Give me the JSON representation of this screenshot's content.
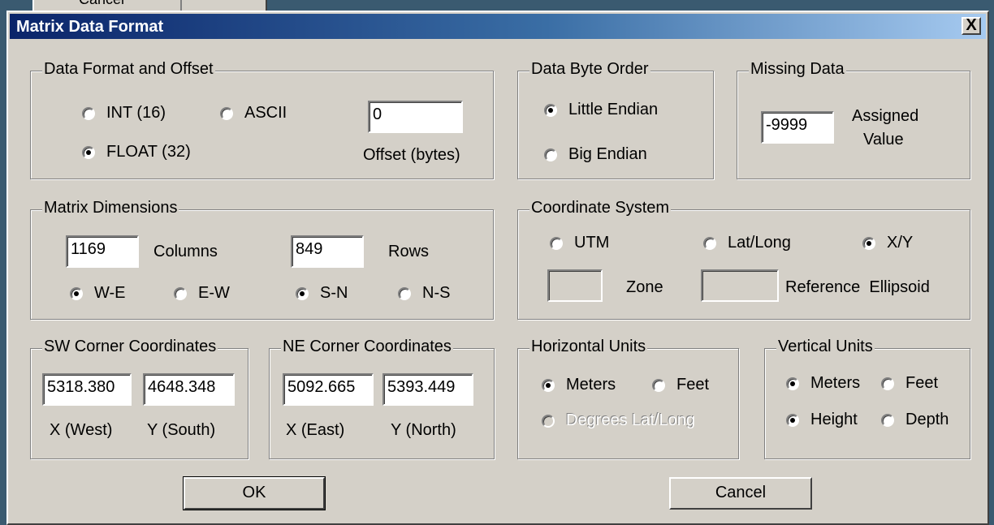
{
  "background_tab": {
    "label": "Cancel"
  },
  "dialog": {
    "title": "Matrix Data Format",
    "close_label": "X"
  },
  "data_format": {
    "legend": "Data Format and Offset",
    "options": [
      {
        "label": "INT (16)",
        "selected": false
      },
      {
        "label": "ASCII",
        "selected": false
      },
      {
        "label": "FLOAT (32)",
        "selected": true
      }
    ],
    "offset_value": "0",
    "offset_label": "Offset (bytes)"
  },
  "byte_order": {
    "legend": "Data Byte Order",
    "options": [
      {
        "label": "Little Endian",
        "selected": true
      },
      {
        "label": "Big Endian",
        "selected": false
      }
    ]
  },
  "missing_data": {
    "legend": "Missing Data",
    "value": "-9999",
    "label_line1": "Assigned",
    "label_line2": "Value"
  },
  "matrix_dimensions": {
    "legend": "Matrix Dimensions",
    "columns_value": "1169",
    "columns_label": "Columns",
    "rows_value": "849",
    "rows_label": "Rows",
    "options": [
      {
        "label": "W-E",
        "selected": true
      },
      {
        "label": "E-W",
        "selected": false
      },
      {
        "label": "S-N",
        "selected": true
      },
      {
        "label": "N-S",
        "selected": false
      }
    ]
  },
  "coordinate_system": {
    "legend": "Coordinate System",
    "options": [
      {
        "label": "UTM",
        "selected": false
      },
      {
        "label": "Lat/Long",
        "selected": false
      },
      {
        "label": "X/Y",
        "selected": true
      }
    ],
    "zone_value": "",
    "zone_label": "Zone",
    "ellipsoid_value": "",
    "ellipsoid_label": "Reference  Ellipsoid"
  },
  "sw_corner": {
    "legend": "SW Corner Coordinates",
    "x_value": "5318.380",
    "y_value": "4648.348",
    "x_label": "X (West)",
    "y_label": "Y (South)"
  },
  "ne_corner": {
    "legend": "NE Corner Coordinates",
    "x_value": "5092.665",
    "y_value": "5393.449",
    "x_label": "X (East)",
    "y_label": "Y (North)"
  },
  "horizontal_units": {
    "legend": "Horizontal Units",
    "options": [
      {
        "label": "Meters",
        "selected": true
      },
      {
        "label": "Feet",
        "selected": false
      },
      {
        "label": "Degrees Lat/Long",
        "selected": false,
        "disabled": true
      }
    ]
  },
  "vertical_units": {
    "legend": "Vertical Units",
    "options": [
      {
        "label": "Meters",
        "selected": true
      },
      {
        "label": "Feet",
        "selected": false
      },
      {
        "label": "Height",
        "selected": true
      },
      {
        "label": "Depth",
        "selected": false
      }
    ]
  },
  "buttons": {
    "ok_label": "OK",
    "cancel_label": "Cancel"
  }
}
